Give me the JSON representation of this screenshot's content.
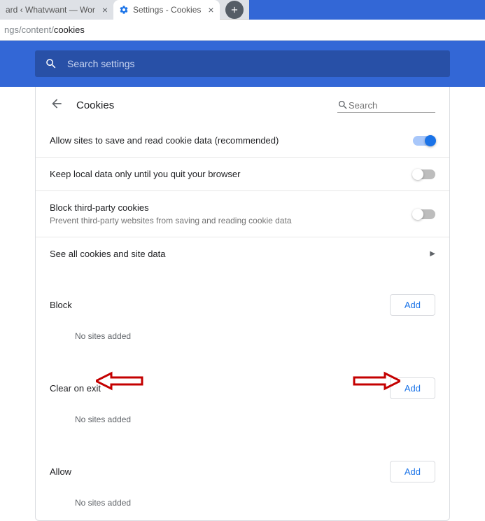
{
  "tabs": {
    "inactive": {
      "label": "ard ‹ Whatvwant — Wor"
    },
    "active": {
      "label": "Settings - Cookies"
    }
  },
  "address": {
    "dim": "ngs/content/",
    "bold": "cookies"
  },
  "search_settings": {
    "placeholder": "Search settings"
  },
  "page": {
    "title": "Cookies",
    "search_placeholder": "Search"
  },
  "settings": {
    "allow_save": "Allow sites to save and read cookie data (recommended)",
    "keep_local": "Keep local data only until you quit your browser",
    "block_third": "Block third-party cookies",
    "block_third_sub": "Prevent third-party websites from saving and reading cookie data",
    "see_all": "See all cookies and site data"
  },
  "sections": {
    "block": {
      "title": "Block",
      "add": "Add",
      "empty": "No sites added"
    },
    "clear_on_exit": {
      "title": "Clear on exit",
      "add": "Add",
      "empty": "No sites added"
    },
    "allow": {
      "title": "Allow",
      "add": "Add",
      "empty": "No sites added"
    }
  }
}
